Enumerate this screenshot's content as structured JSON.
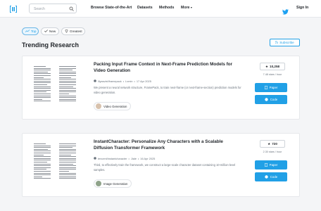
{
  "nav": {
    "search_placeholder": "Search",
    "links": [
      "Browse State-of-the-Art",
      "Datasets",
      "Methods",
      "More"
    ],
    "signin": "Sign In"
  },
  "filters": [
    {
      "label": "Top",
      "icon": "trend-icon",
      "active": true
    },
    {
      "label": "New",
      "icon": "check-icon",
      "active": false
    },
    {
      "label": "Greatest",
      "icon": "trophy-icon",
      "active": false
    }
  ],
  "section": {
    "title": "Trending Research",
    "subscribe": "Subscribe"
  },
  "papers": [
    {
      "title": "Packing Input Frame Context in Next-Frame Prediction Models for Video Generation",
      "repo": "lllyasviel/framepack",
      "sep": "•",
      "author": "Lvmin",
      "date": "17 Apr 2025",
      "abstract": "We present a neural network structure, FramePack, to train next-frame (or next-frame-section) prediction models for video generation.",
      "tag": "Video Generation",
      "stars": "10,258",
      "rate": "7.48 stars / hour",
      "paper_label": "Paper",
      "code_label": "Code"
    },
    {
      "title": "InstantCharacter: Personalize Any Characters with a Scalable Diffusion Transformer Framework",
      "repo": "tencent/instantcharacter",
      "sep": "•",
      "author": "Jiale",
      "date": "16 Apr 2025",
      "abstract": "Third, to effectively train the framework, we construct a large-scale character dataset containing 10-million-level samples.",
      "tag": "Image Generation",
      "stars": "720",
      "rate": "2.30 stars / hour",
      "paper_label": "Paper",
      "code_label": "Code"
    }
  ],
  "colors": {
    "accent": "#21a0e6",
    "twitter": "#1da1f2"
  }
}
